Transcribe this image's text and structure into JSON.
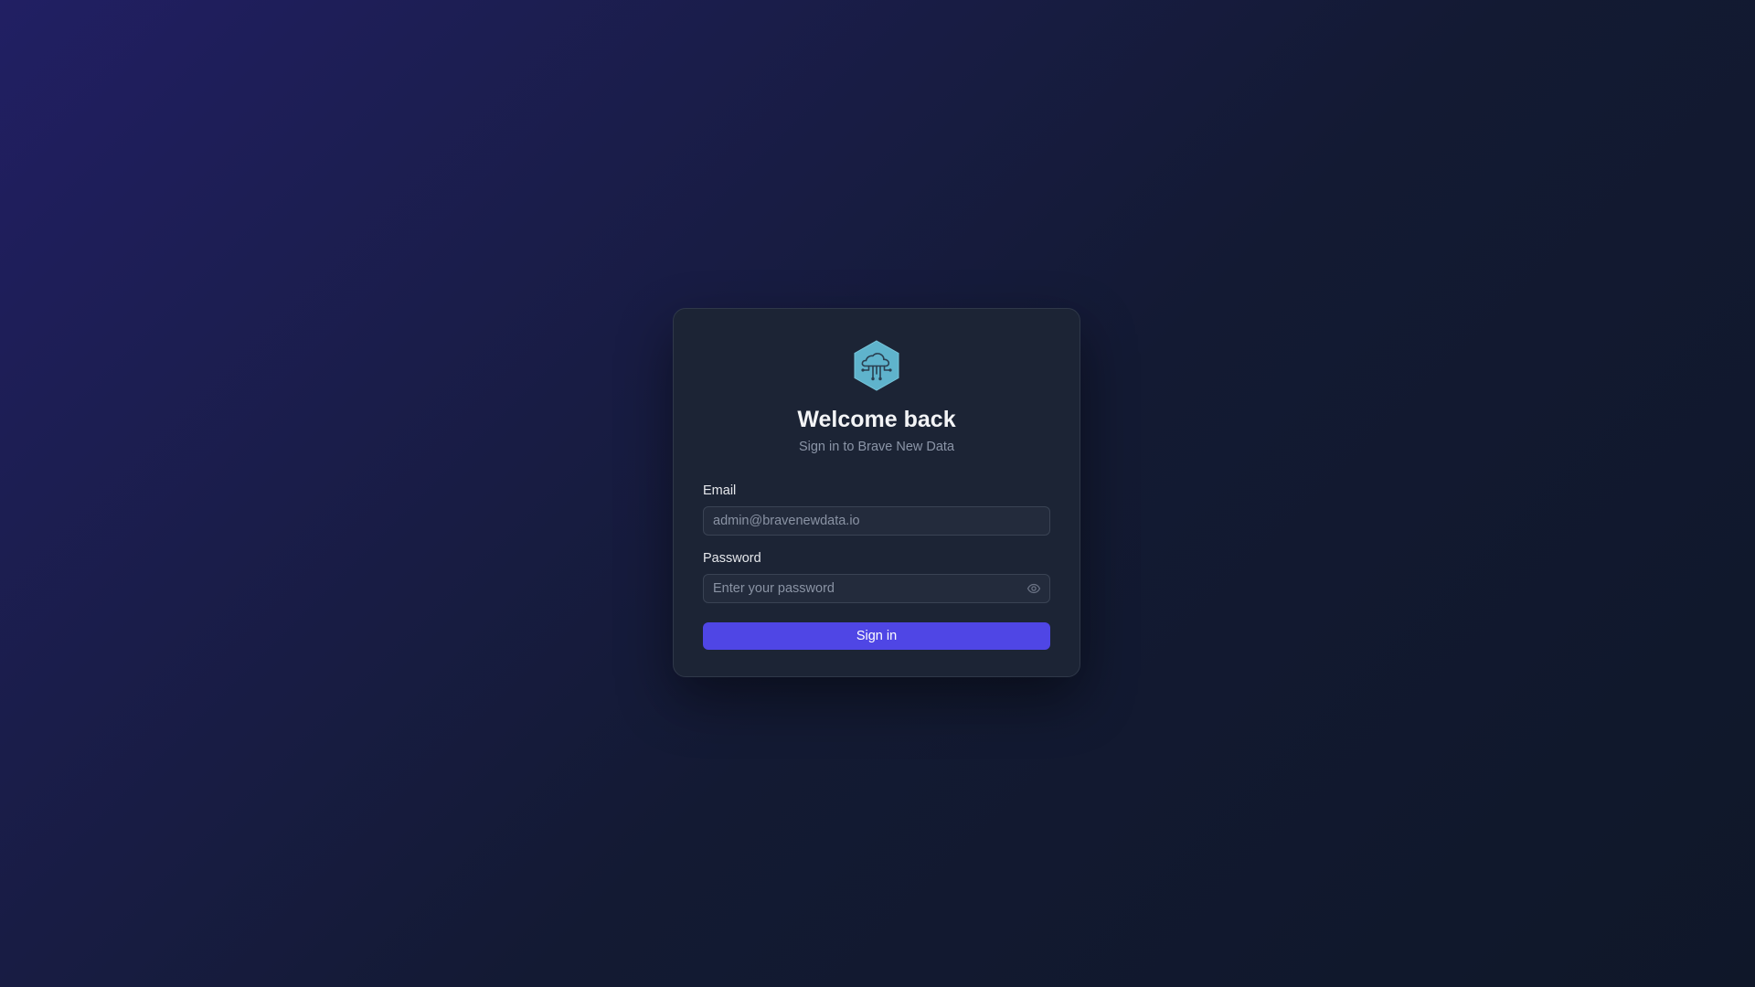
{
  "header": {
    "logo_icon": "cloud-network-hex-icon",
    "title": "Welcome back",
    "subtitle": "Sign in to Brave New Data"
  },
  "form": {
    "email": {
      "label": "Email",
      "value": "",
      "placeholder": "admin@bravenewdata.io"
    },
    "password": {
      "label": "Password",
      "value": "",
      "placeholder": "Enter your password",
      "toggle_icon": "eye-icon"
    },
    "submit_label": "Sign in"
  },
  "colors": {
    "accent": "#4f46e5",
    "logo": "#5fb3cc",
    "card": "#1c2435"
  }
}
